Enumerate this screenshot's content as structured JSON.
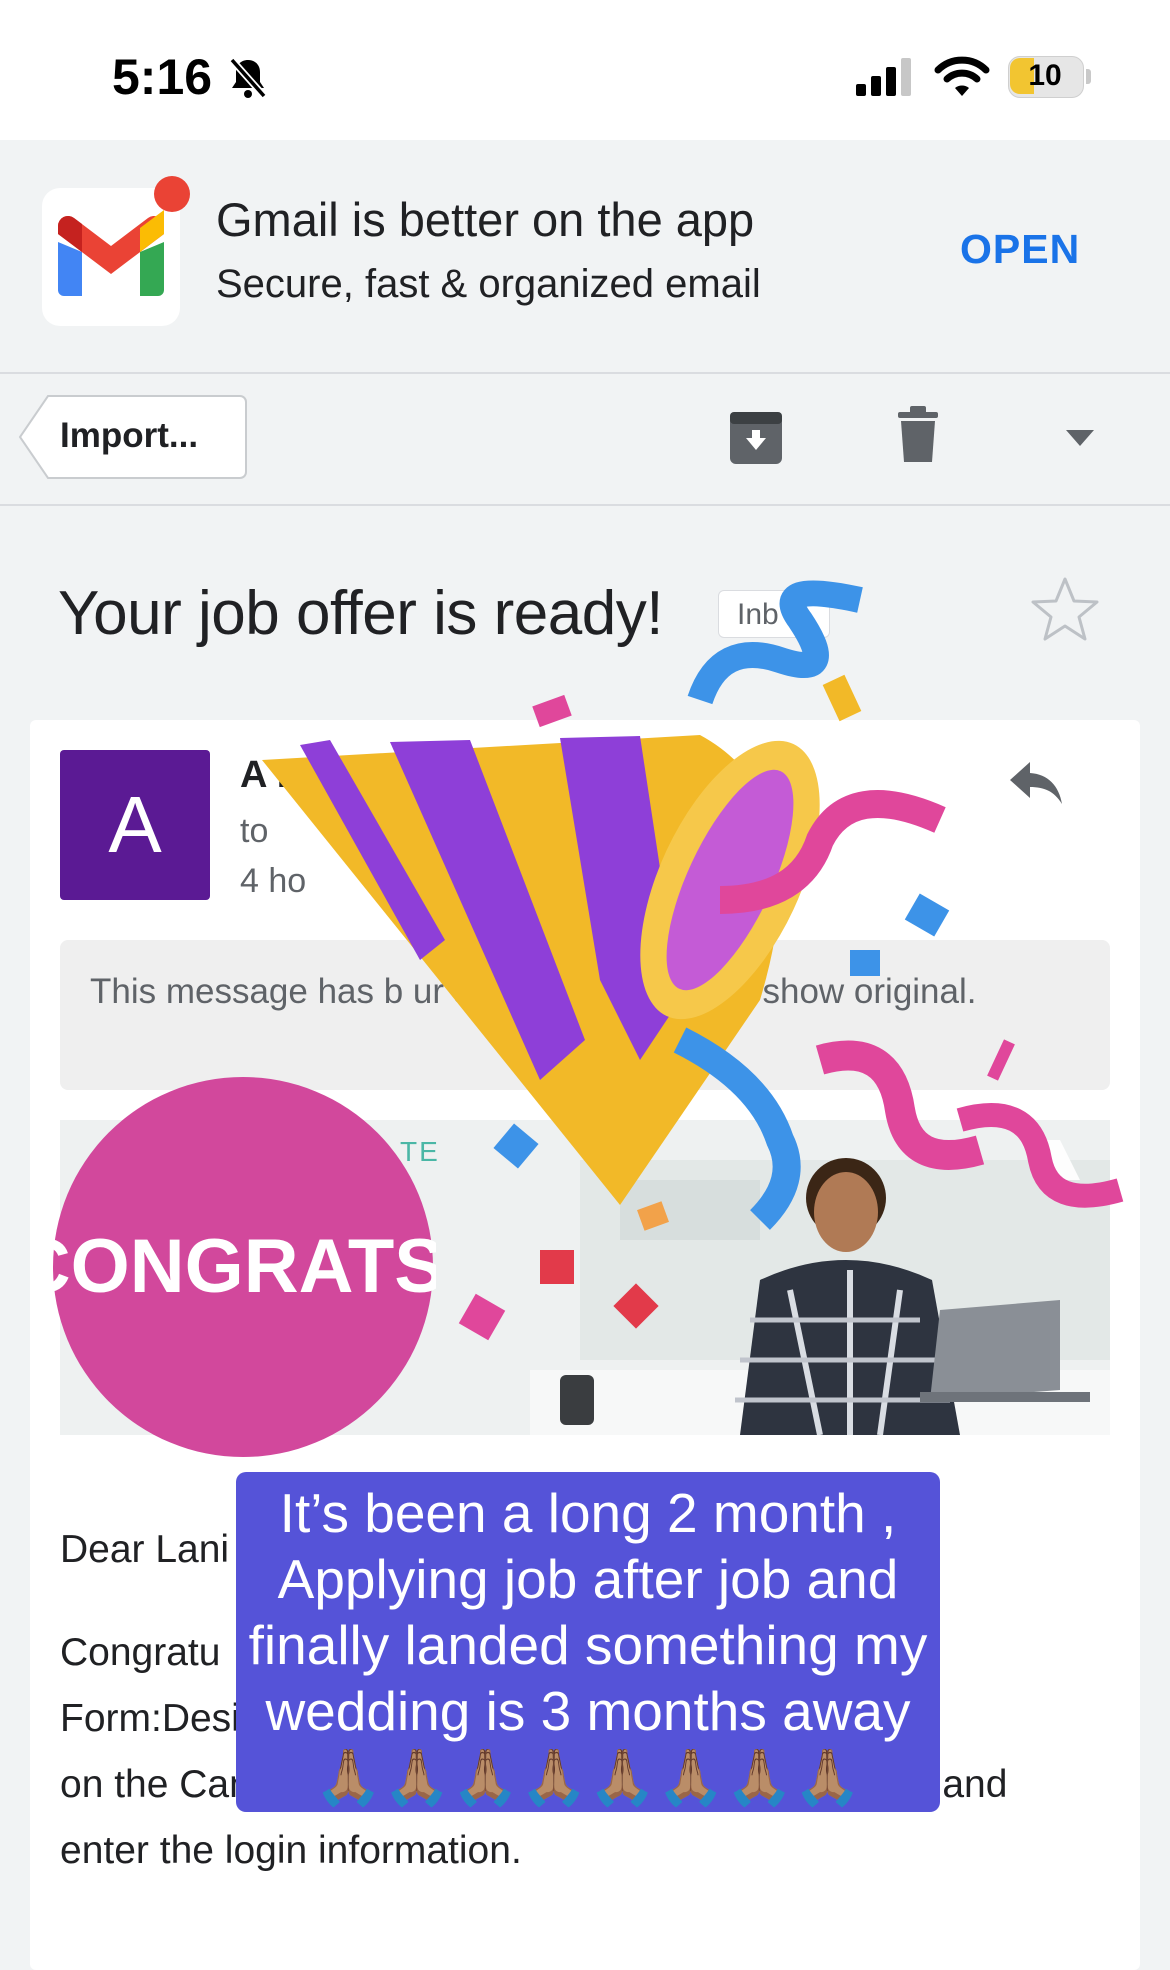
{
  "status_bar": {
    "time": "5:16",
    "battery_level": "10",
    "icons": [
      "bell-slash-icon",
      "signal-icon",
      "wifi-icon",
      "battery-icon"
    ]
  },
  "promo": {
    "title": "Gmail is better on the app",
    "subtitle": "Secure, fast & organized email",
    "open_label": "OPEN",
    "icon": "gmail-logo-icon"
  },
  "toolbar": {
    "back_label": "Import...",
    "icons": [
      "archive-icon",
      "trash-icon",
      "dropdown-icon"
    ]
  },
  "message": {
    "subject": "Your job offer is ready!",
    "label": "Inb",
    "avatar_letter": "A",
    "sender": "A                                                          ng c...",
    "to": "to",
    "time": "4 ho",
    "notice": "This message has b                                   ur screen. Tap here to show original.",
    "hero_brand": "TE",
    "greeting": "Dear Lani",
    "body_lines": [
      "Congratu",
      "Form:Desi                                                              review",
      "on the Candidate Zone. Please click the link below and",
      "enter the login information."
    ]
  },
  "overlay": {
    "sticker_text": "CONGRATS!",
    "caption": "It’s been a long 2 month , Applying job after job and finally landed something my wedding is 3 months away🙏🏽🙏🏽🙏🏽🙏🏽🙏🏽🙏🏽🙏🏽🙏🏽"
  },
  "colors": {
    "accent": "#1a73e8",
    "avatar": "#5b1a94",
    "caption_bg": "#5553d8",
    "sticker": "#d2489c",
    "notif_dot": "#ea4335"
  }
}
